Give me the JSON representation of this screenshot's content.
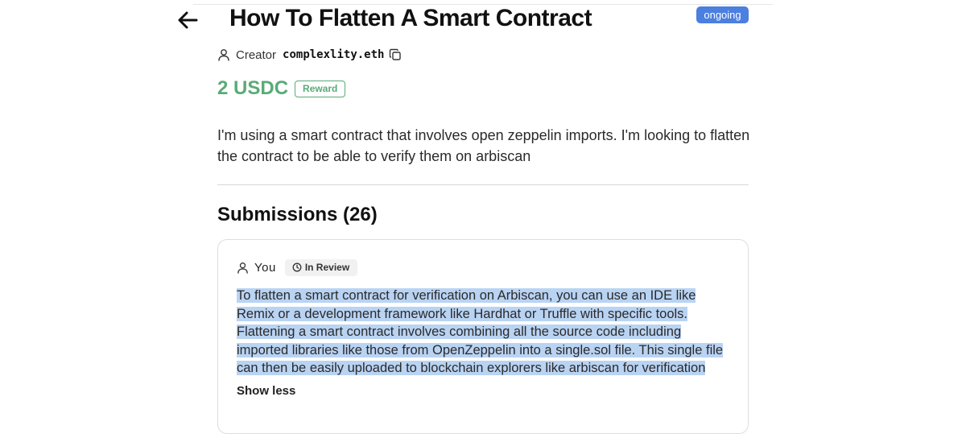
{
  "task": {
    "title": "How To Flatten A Smart Contract",
    "status": "ongoing",
    "creator_label": "Creator",
    "creator_name": "complexlity.eth",
    "reward_amount": "2 USDC",
    "reward_badge": "Reward",
    "description": "I'm using a smart contract that involves open zeppelin imports. I'm looking to flatten the contract to be able to verify them on arbiscan"
  },
  "submissions": {
    "heading": "Submissions (26)",
    "items": [
      {
        "author": "You",
        "status": "In Review",
        "text": "To flatten a smart contract for verification on Arbiscan, you can use an IDE like Remix or a development framework like Hardhat or Truffle with specific tools. Flattening a smart contract involves combining all the source code including imported libraries like those from OpenZeppelin into a single.sol file. This single file can then be easily uploaded to blockchain explorers like arbiscan for verification",
        "toggle_label": "Show less"
      }
    ]
  },
  "colors": {
    "accent_blue": "#4b7fe0",
    "reward_green": "#5aaa78",
    "selection_highlight": "#b9d3f3"
  },
  "icons": {
    "back": "arrow-left-icon",
    "creator": "user-icon",
    "copy": "copy-icon",
    "submission_author": "user-icon",
    "review": "clock-icon"
  }
}
